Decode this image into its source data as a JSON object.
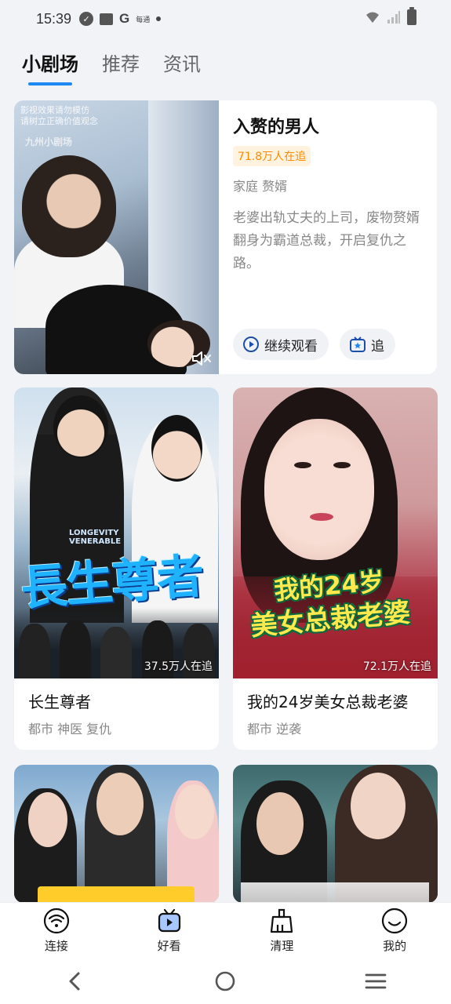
{
  "status_bar": {
    "time": "15:39",
    "notif_small": "每通"
  },
  "tabs": [
    {
      "label": "小剧场",
      "active": true
    },
    {
      "label": "推荐",
      "active": false
    },
    {
      "label": "资讯",
      "active": false
    }
  ],
  "featured": {
    "title": "入赘的男人",
    "followers": "71.8万人在追",
    "tags": "家庭 赘婿",
    "description": "老婆出轨丈夫的上司，废物赘婿翻身为霸道总裁，开启复仇之路。",
    "watermark_line1": "影视效果请勿模仿",
    "watermark_line2": "请树立正确价值观念",
    "watermark_brand": "九州小剧场",
    "continue_label": "继续观看",
    "follow_label": "追"
  },
  "cards": [
    {
      "title": "长生尊者",
      "tags": "都市 神医 复仇",
      "followers": "37.5万人在追",
      "poster_title": "長生尊者",
      "poster_sub": "LONGEVITY VENERABLE"
    },
    {
      "title": "我的24岁美女总裁老婆",
      "tags": "都市 逆袭",
      "followers": "72.1万人在追",
      "poster_title_1": "我的24岁",
      "poster_title_2": "美女总裁老婆"
    }
  ],
  "bottom_nav": [
    {
      "label": "连接",
      "icon": "wifi-icon"
    },
    {
      "label": "好看",
      "icon": "tv-icon"
    },
    {
      "label": "清理",
      "icon": "broom-icon"
    },
    {
      "label": "我的",
      "icon": "smile-icon"
    }
  ],
  "colors": {
    "accent": "#1e88f5",
    "badge_bg": "#fff3e0",
    "badge_text": "#ff8a00",
    "background": "#f2f3f7"
  }
}
